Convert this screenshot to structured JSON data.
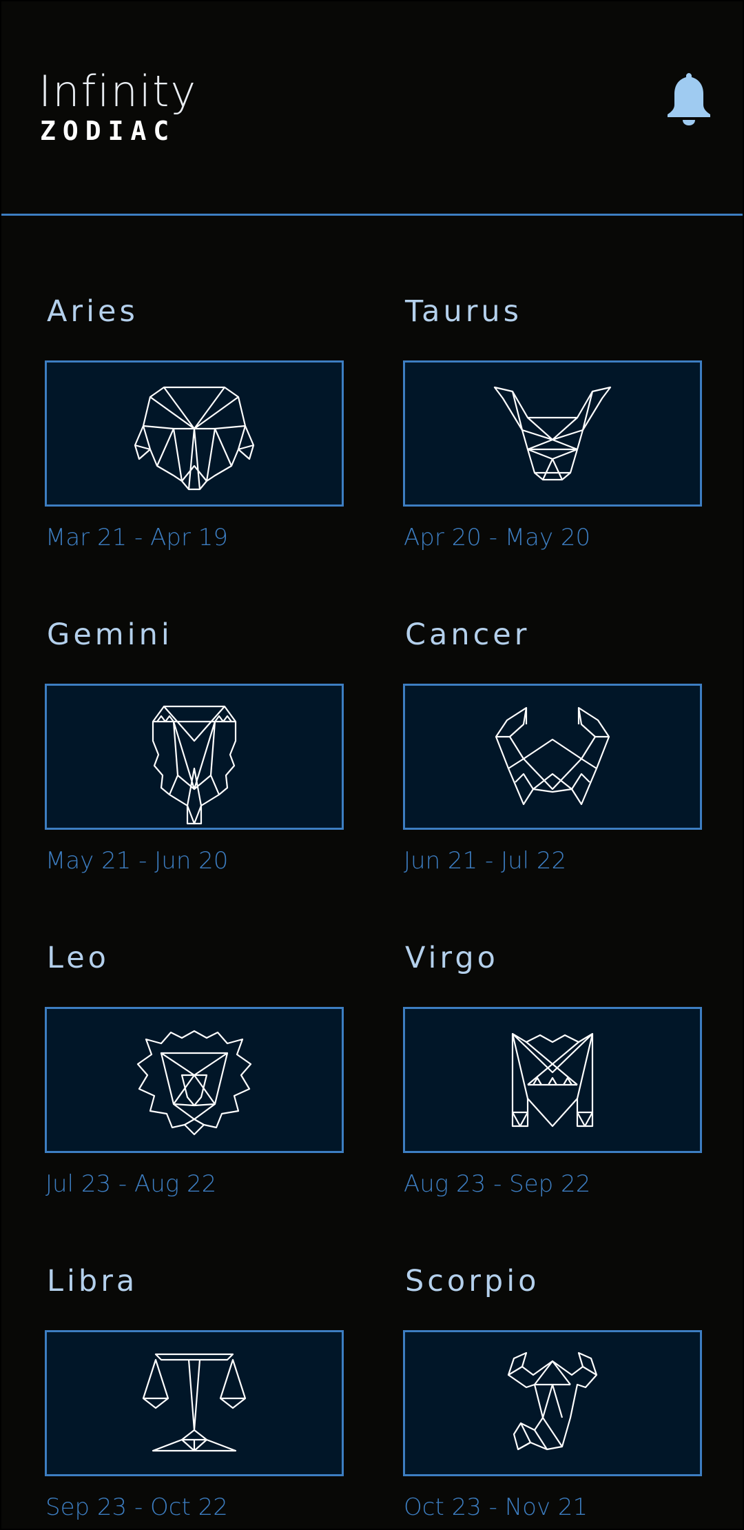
{
  "header": {
    "logo_line1": "Infinity",
    "logo_line2": "ZODIAC",
    "bell_icon": "bell-icon"
  },
  "colors": {
    "background": "#080806",
    "accent": "#3d7ec2",
    "card_fill": "#011628",
    "title": "#b4d0ec",
    "bell": "#9fcbf1"
  },
  "signs": [
    {
      "name": "Aries",
      "dates": "Mar 21 - Apr 19",
      "icon": "ram-icon"
    },
    {
      "name": "Taurus",
      "dates": "Apr 20 - May 20",
      "icon": "bull-icon"
    },
    {
      "name": "Gemini",
      "dates": "May 21 - Jun 20",
      "icon": "twins-icon"
    },
    {
      "name": "Cancer",
      "dates": "Jun 21 - Jul 22",
      "icon": "crab-icon"
    },
    {
      "name": "Leo",
      "dates": "Jul 23 - Aug 22",
      "icon": "lion-icon"
    },
    {
      "name": "Virgo",
      "dates": "Aug 23 - Sep 22",
      "icon": "virgo-icon"
    },
    {
      "name": "Libra",
      "dates": "Sep 23 - Oct 22",
      "icon": "scales-icon"
    },
    {
      "name": "Scorpio",
      "dates": "Oct 23 - Nov 21",
      "icon": "scorpion-icon"
    }
  ]
}
